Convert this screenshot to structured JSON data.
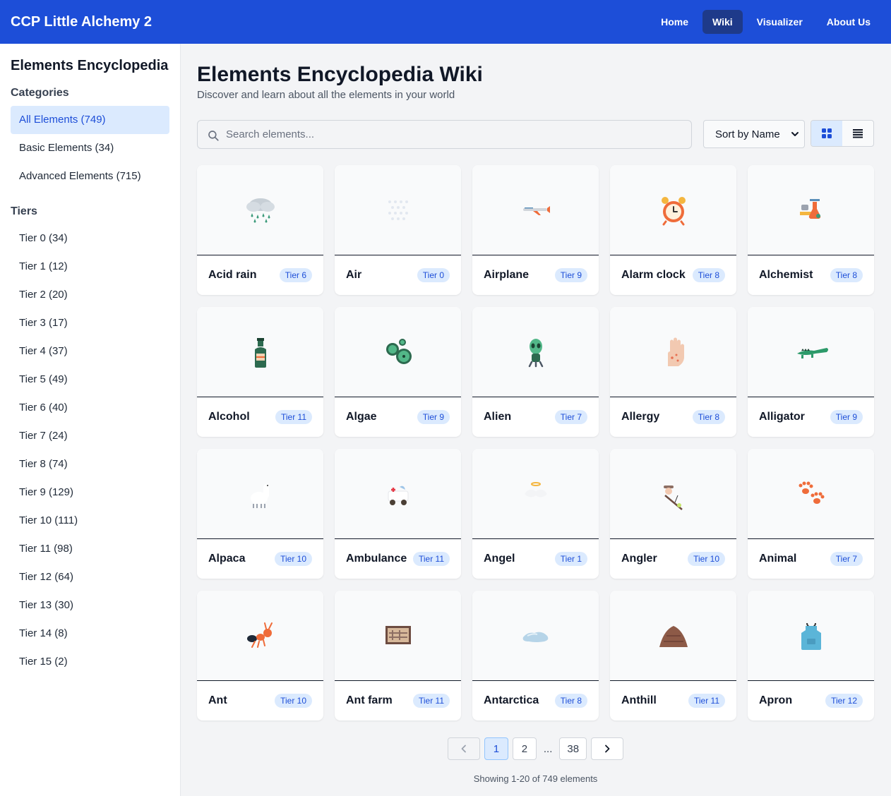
{
  "app": {
    "title": "CCP Little Alchemy 2"
  },
  "nav": [
    {
      "label": "Home",
      "active": false
    },
    {
      "label": "Wiki",
      "active": true
    },
    {
      "label": "Visualizer",
      "active": false
    },
    {
      "label": "About Us",
      "active": false
    }
  ],
  "sidebar": {
    "title": "Elements Encyclopedia",
    "categories_heading": "Categories",
    "categories": [
      {
        "label": "All Elements (749)",
        "active": true
      },
      {
        "label": "Basic Elements (34)",
        "active": false
      },
      {
        "label": "Advanced Elements (715)",
        "active": false
      }
    ],
    "tiers_heading": "Tiers",
    "tiers": [
      "Tier 0 (34)",
      "Tier 1 (12)",
      "Tier 2 (20)",
      "Tier 3 (17)",
      "Tier 4 (37)",
      "Tier 5 (49)",
      "Tier 6 (40)",
      "Tier 7 (24)",
      "Tier 8 (74)",
      "Tier 9 (129)",
      "Tier 10 (111)",
      "Tier 11 (98)",
      "Tier 12 (64)",
      "Tier 13 (30)",
      "Tier 14 (8)",
      "Tier 15 (2)"
    ]
  },
  "main": {
    "title": "Elements Encyclopedia Wiki",
    "subtitle": "Discover and learn about all the elements in your world",
    "search": {
      "placeholder": "Search elements...",
      "value": ""
    },
    "sort": {
      "selected": "Sort by Name"
    },
    "view": {
      "active": "grid"
    }
  },
  "elements": [
    {
      "name": "Acid rain",
      "tier": "Tier 6",
      "icon": "acid-rain-icon"
    },
    {
      "name": "Air",
      "tier": "Tier 0",
      "icon": "air-icon"
    },
    {
      "name": "Airplane",
      "tier": "Tier 9",
      "icon": "airplane-icon"
    },
    {
      "name": "Alarm clock",
      "tier": "Tier 8",
      "icon": "alarm-clock-icon"
    },
    {
      "name": "Alchemist",
      "tier": "Tier 8",
      "icon": "alchemist-icon"
    },
    {
      "name": "Alcohol",
      "tier": "Tier 11",
      "icon": "alcohol-icon"
    },
    {
      "name": "Algae",
      "tier": "Tier 9",
      "icon": "algae-icon"
    },
    {
      "name": "Alien",
      "tier": "Tier 7",
      "icon": "alien-icon"
    },
    {
      "name": "Allergy",
      "tier": "Tier 8",
      "icon": "allergy-icon"
    },
    {
      "name": "Alligator",
      "tier": "Tier 9",
      "icon": "alligator-icon"
    },
    {
      "name": "Alpaca",
      "tier": "Tier 10",
      "icon": "alpaca-icon"
    },
    {
      "name": "Ambulance",
      "tier": "Tier 11",
      "icon": "ambulance-icon"
    },
    {
      "name": "Angel",
      "tier": "Tier 1",
      "icon": "angel-icon"
    },
    {
      "name": "Angler",
      "tier": "Tier 10",
      "icon": "angler-icon"
    },
    {
      "name": "Animal",
      "tier": "Tier 7",
      "icon": "animal-icon"
    },
    {
      "name": "Ant",
      "tier": "Tier 10",
      "icon": "ant-icon"
    },
    {
      "name": "Ant farm",
      "tier": "Tier 11",
      "icon": "ant-farm-icon"
    },
    {
      "name": "Antarctica",
      "tier": "Tier 8",
      "icon": "antarctica-icon"
    },
    {
      "name": "Anthill",
      "tier": "Tier 11",
      "icon": "anthill-icon"
    },
    {
      "name": "Apron",
      "tier": "Tier 12",
      "icon": "apron-icon"
    }
  ],
  "pagination": {
    "pages": [
      "1",
      "2",
      "...",
      "38"
    ],
    "current": "1",
    "summary": "Showing 1-20 of 749 elements"
  },
  "colors": {
    "header": "#1d4ed8",
    "accent": "#1d4ed8",
    "badge_bg": "#dbeafe"
  }
}
